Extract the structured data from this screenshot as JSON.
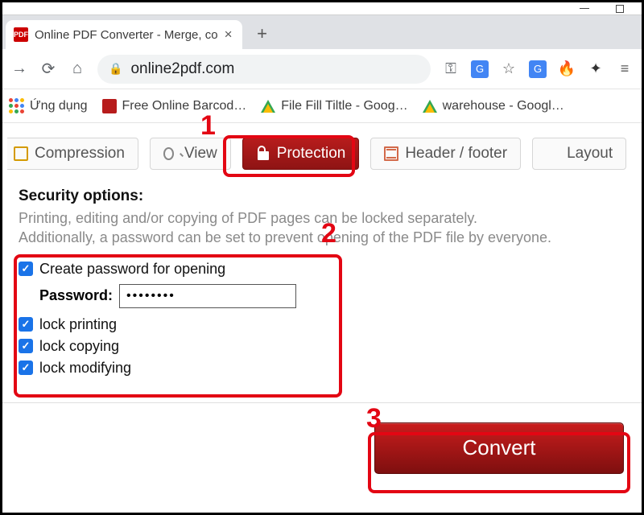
{
  "browser": {
    "tab_title": "Online PDF Converter - Merge, co",
    "favicon_text": "PDF",
    "url_display": "online2pdf.com"
  },
  "bookmarks": {
    "apps_label": "Ứng dụng",
    "items": [
      "Free Online Barcod…",
      "File Fill Tiltle - Goog…",
      "warehouse - Googl…"
    ]
  },
  "tabs": {
    "compression": "Compression",
    "view": "View",
    "protection": "Protection",
    "header_footer": "Header / footer",
    "layout": "Layout"
  },
  "security": {
    "heading": "Security options:",
    "desc1": "Printing, editing and/or copying of PDF pages can be locked separately.",
    "desc2": "Additionally, a password can be set to prevent opening of the PDF file by everyone.",
    "create_pw_label": "Create password for opening",
    "password_label": "Password:",
    "password_value": "••••••••",
    "lock_printing": "lock printing",
    "lock_copying": "lock copying",
    "lock_modifying": "lock modifying"
  },
  "convert_label": "Convert",
  "annotations": {
    "n1": "1",
    "n2": "2",
    "n3": "3"
  }
}
